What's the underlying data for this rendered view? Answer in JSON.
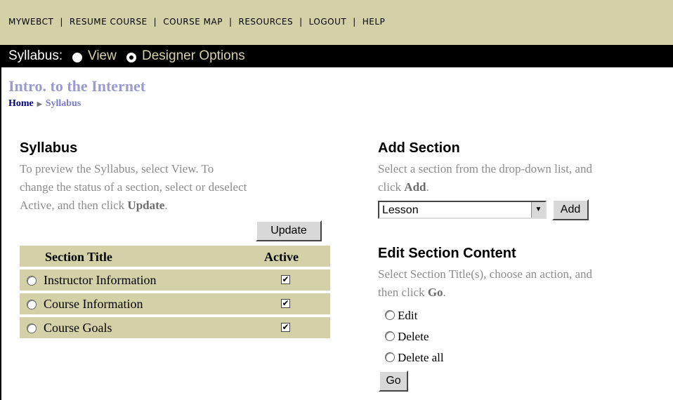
{
  "nav": {
    "items": [
      "MYWEBCT",
      "RESUME COURSE",
      "COURSE MAP",
      "RESOURCES",
      "LOGOUT",
      "HELP"
    ],
    "separator": "|"
  },
  "modebar": {
    "label": "Syllabus:",
    "view": "View",
    "designer": "Designer Options",
    "selected": "Designer Options"
  },
  "course": {
    "title": "Intro. to the Internet",
    "breadcrumb_home": "Home",
    "breadcrumb_current": "Syllabus"
  },
  "syllabus": {
    "heading": "Syllabus",
    "help_line1": "To preview the Syllabus, select View. To",
    "help_line2": "change the status of a section, select or deselect",
    "help_line3_prefix": "Active, and then click ",
    "help_line3_bold": "Update",
    "help_line3_suffix": ".",
    "update_button": "Update",
    "col_title": "Section Title",
    "col_active": "Active",
    "rows": [
      {
        "title": "Instructor Information",
        "active": true
      },
      {
        "title": "Course Information",
        "active": true
      },
      {
        "title": "Course Goals",
        "active": true
      }
    ]
  },
  "add_section": {
    "heading": "Add Section",
    "help_line1": "Select a section from the drop-down list, and",
    "help_line2_prefix": "click ",
    "help_line2_bold": "Add",
    "help_line2_suffix": ".",
    "select_value": "Lesson",
    "add_button": "Add"
  },
  "edit_section": {
    "heading": "Edit Section Content",
    "help_line1": "Select Section Title(s), choose an action, and",
    "help_line2_prefix": "then click ",
    "help_line2_bold": "Go",
    "help_line2_suffix": ".",
    "options": [
      "Edit",
      "Delete",
      "Delete all"
    ],
    "go_button": "Go"
  },
  "colors": {
    "nav_bg": "#d4d0a8",
    "bar_bg": "#000000",
    "course_title": "#9b9bd0",
    "help_text": "#8c8c8c"
  }
}
